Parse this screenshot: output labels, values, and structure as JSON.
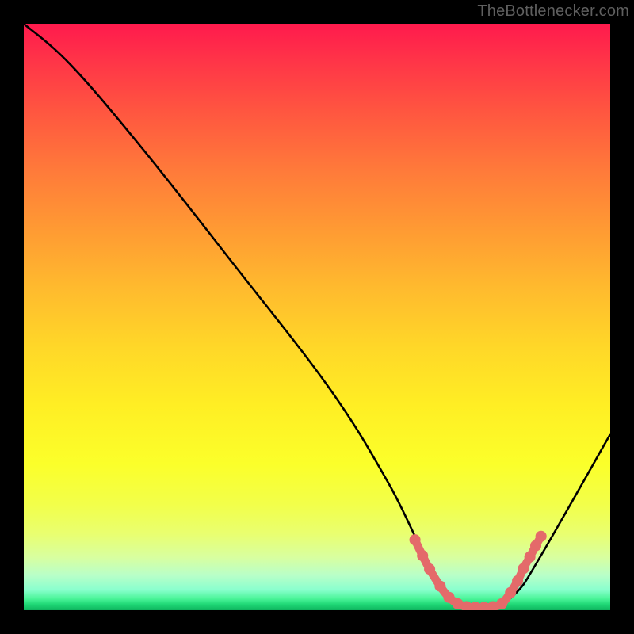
{
  "attribution": "TheBottlenecker.com",
  "chart_data": {
    "type": "line",
    "title": "",
    "xlabel": "",
    "ylabel": "",
    "xlim": [
      0,
      100
    ],
    "ylim": [
      0,
      100
    ],
    "series": [
      {
        "name": "bottleneck-curve",
        "x": [
          0,
          8,
          20,
          35,
          52,
          62,
          68,
          72,
          76,
          80,
          84,
          88,
          100
        ],
        "y": [
          100,
          93,
          79,
          60,
          38,
          22,
          10,
          3,
          0.5,
          0.5,
          3,
          9,
          30
        ]
      }
    ],
    "highlight": {
      "name": "sweet-spot",
      "points_x": [
        66.7,
        68,
        69.2,
        71,
        72.5,
        74,
        75.5,
        77,
        78.5,
        80,
        81.5,
        83,
        84.2,
        85.2,
        86.3,
        87.3,
        88.2
      ],
      "points_y": [
        12,
        9.3,
        7,
        4.1,
        2.2,
        1.1,
        0.6,
        0.5,
        0.5,
        0.6,
        1.1,
        3,
        5,
        7.1,
        9.1,
        11,
        12.6
      ],
      "color": "#e46a6a"
    }
  }
}
